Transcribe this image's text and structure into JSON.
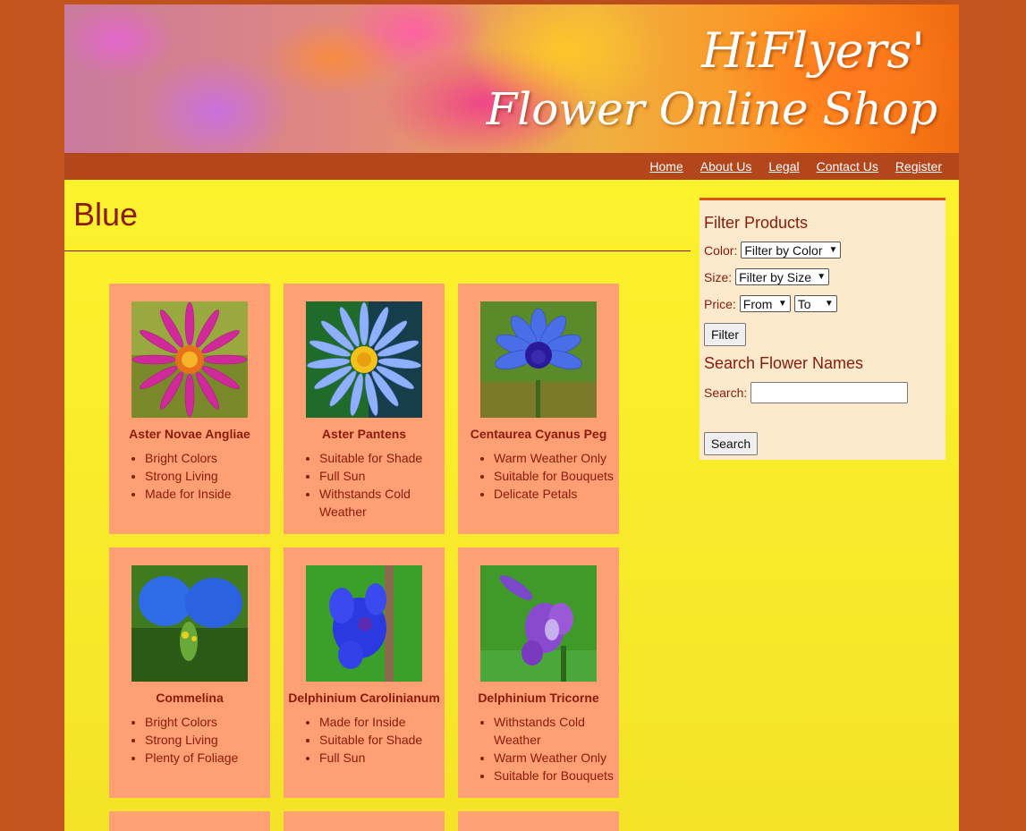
{
  "banner": {
    "line1": "HiFlyers'",
    "line2": "Flower Online Shop"
  },
  "nav": {
    "items": [
      "Home",
      "About Us",
      "Legal",
      "Contact Us",
      "Register"
    ]
  },
  "page": {
    "title": "Blue"
  },
  "products": [
    {
      "name": "Aster Novae Angliae",
      "features": [
        "Bright Colors",
        "Strong Living",
        "Made for Inside"
      ],
      "image": "pink-aster-flower"
    },
    {
      "name": "Aster Pantens",
      "features": [
        "Suitable for Shade",
        "Full Sun",
        "Withstands Cold Weather"
      ],
      "image": "blue-aster-flower"
    },
    {
      "name": "Centaurea Cyanus Peg",
      "features": [
        "Warm Weather Only",
        "Suitable for Bouquets",
        "Delicate Petals"
      ],
      "image": "cornflower"
    },
    {
      "name": "Commelina",
      "features": [
        "Bright Colors",
        "Strong Living",
        "Plenty of Foliage"
      ],
      "image": "dayflower"
    },
    {
      "name": "Delphinium Carolinianum",
      "features": [
        "Made for Inside",
        "Suitable for Shade",
        "Full Sun"
      ],
      "image": "blue-larkspur"
    },
    {
      "name": "Delphinium Tricorne",
      "features": [
        "Withstands Cold Weather",
        "Warm Weather Only",
        "Suitable for Bouquets"
      ],
      "image": "purple-larkspur"
    }
  ],
  "filter": {
    "heading": "Filter Products",
    "color_label": "Color:",
    "color_value": "Filter by Color",
    "size_label": "Size:",
    "size_value": "Filter by Size",
    "price_label": "Price:",
    "price_from": "From",
    "price_to": "To",
    "button": "Filter"
  },
  "search": {
    "heading": "Search Flower Names",
    "label": "Search:",
    "value": "",
    "button": "Search"
  },
  "colors": {
    "page_bg": "#c4551d",
    "nav_bg": "#b3461b",
    "content_bg": "#fdf22e",
    "card_bg": "#ff9f74",
    "sidebar_bg": "#fde9cc",
    "text": "#8a1a0a",
    "accent": "#e0550e"
  }
}
